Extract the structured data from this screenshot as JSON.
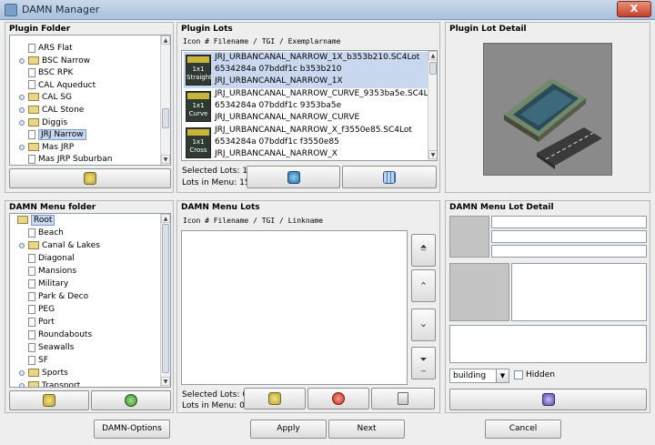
{
  "window": {
    "title": "DAMN Manager",
    "close_label": "X"
  },
  "plugin_folder": {
    "title": "Plugin Folder",
    "items": [
      {
        "label": "ARS Flat",
        "type": "file",
        "indent": 1
      },
      {
        "label": "BSC Narrow",
        "type": "folder",
        "indent": 1
      },
      {
        "label": "BSC RPK",
        "type": "file",
        "indent": 1
      },
      {
        "label": "CAL Aqueduct",
        "type": "file",
        "indent": 1
      },
      {
        "label": "CAL SG",
        "type": "folder",
        "indent": 1
      },
      {
        "label": "CAL Stone",
        "type": "folder",
        "indent": 1
      },
      {
        "label": "Diggis",
        "type": "folder",
        "indent": 1
      },
      {
        "label": "JRJ Narrow",
        "type": "file",
        "indent": 1,
        "selected": true
      },
      {
        "label": "Mas JRP",
        "type": "folder",
        "indent": 1
      },
      {
        "label": "Mas JRP Suburban",
        "type": "file",
        "indent": 1
      }
    ]
  },
  "plugin_lots": {
    "title": "Plugin Lots",
    "header": "Icon # Filename / TGI / Exemplarname",
    "lots": [
      {
        "thumb_top": "1x1",
        "thumb_bottom": "Straight",
        "filename": "JRJ_URBANCANAL_NARROW_1X_b353b210.SC4Lot",
        "tgi": "6534284a 07bddf1c b353b210",
        "exemplar": "JRJ_URBANCANAL_NARROW_1X",
        "selected": true
      },
      {
        "thumb_top": "1x1",
        "thumb_bottom": "Curve",
        "filename": "JRJ_URBANCANAL_NARROW_CURVE_9353ba5e.SC4Lot",
        "tgi": "6534284a 07bddf1c 9353ba5e",
        "exemplar": "JRJ_URBANCANAL_NARROW_CURVE",
        "selected": false
      },
      {
        "thumb_top": "1x1",
        "thumb_bottom": "Cross",
        "filename": "JRJ_URBANCANAL_NARROW_X_f3550e85.SC4Lot",
        "tgi": "6534284a 07bddf1c f3550e85",
        "exemplar": "JRJ_URBANCANAL_NARROW_X",
        "selected": false
      }
    ],
    "selected_lots_label": "Selected Lots: 1",
    "lots_in_menu_label": "Lots in Menu: 15"
  },
  "plugin_lot_detail": {
    "title": "Plugin Lot Detail"
  },
  "damn_menu_folder": {
    "title": "DAMN Menu folder",
    "items": [
      {
        "label": "Root",
        "type": "folder",
        "indent": 0,
        "selected": true
      },
      {
        "label": "Beach",
        "type": "file",
        "indent": 1
      },
      {
        "label": "Canal & Lakes",
        "type": "folder",
        "indent": 1
      },
      {
        "label": "Diagonal",
        "type": "file",
        "indent": 1
      },
      {
        "label": "Mansions",
        "type": "file",
        "indent": 1
      },
      {
        "label": "Military",
        "type": "file",
        "indent": 1
      },
      {
        "label": "Park & Deco",
        "type": "file",
        "indent": 1
      },
      {
        "label": "PEG",
        "type": "file",
        "indent": 1
      },
      {
        "label": "Port",
        "type": "file",
        "indent": 1
      },
      {
        "label": "Roundabouts",
        "type": "file",
        "indent": 1
      },
      {
        "label": "Seawalls",
        "type": "file",
        "indent": 1
      },
      {
        "label": "SF",
        "type": "file",
        "indent": 1
      },
      {
        "label": "Sports",
        "type": "folder",
        "indent": 1
      },
      {
        "label": "Transport",
        "type": "folder",
        "indent": 1
      }
    ]
  },
  "damn_menu_lots": {
    "title": "DAMN Menu Lots",
    "header": "Icon # Filename / TGI / Linkname",
    "selected_lots_label": "Selected Lots: 0",
    "lots_in_menu_label": "Lots in Menu: 0"
  },
  "damn_menu_lot_detail": {
    "title": "DAMN Menu Lot Detail",
    "category_value": "building",
    "hidden_label": "Hidden",
    "hidden_checked": false
  },
  "bottom_bar": {
    "damn_options_label": "DAMN-Options",
    "apply_label": "Apply",
    "next_label": "Next",
    "cancel_label": "Cancel"
  },
  "colors": {
    "selection": "#c9d8ee",
    "panel_bg": "#eeeeee",
    "remove_red": "#d43b2a",
    "add_green": "#4aa33a"
  }
}
